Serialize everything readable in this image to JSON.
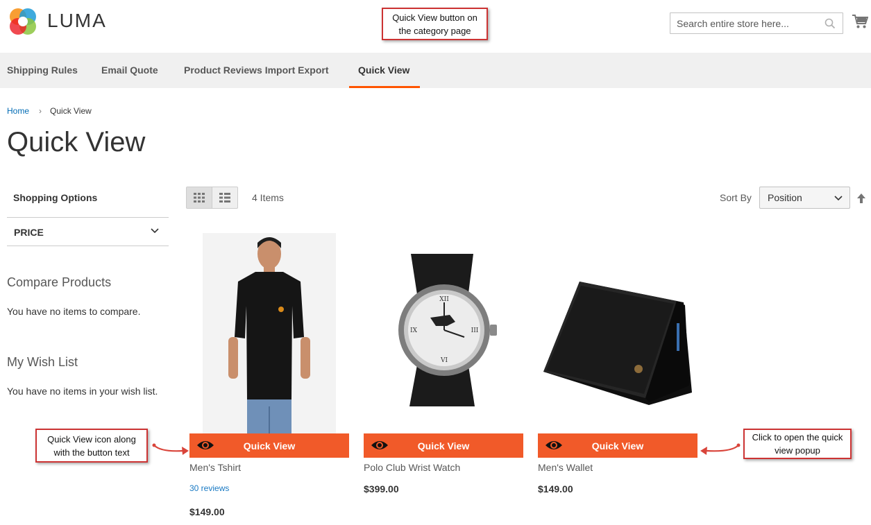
{
  "header": {
    "brand": "LUMA",
    "search_placeholder": "Search entire store here...",
    "icons": {
      "search": "search-icon",
      "cart": "cart-icon",
      "logo": "luma-logo-icon"
    }
  },
  "nav": {
    "items": [
      {
        "label": "Shipping Rules",
        "active": false
      },
      {
        "label": "Email Quote",
        "active": false
      },
      {
        "label": "Product Reviews Import Export",
        "active": false
      },
      {
        "label": "Quick View",
        "active": true
      }
    ]
  },
  "breadcrumb": {
    "home": "Home",
    "current": "Quick View"
  },
  "page_title": "Quick View",
  "sidebar": {
    "shopping_options": "Shopping Options",
    "price_filter": "PRICE",
    "compare_title": "Compare Products",
    "compare_empty": "You have no items to compare.",
    "wishlist_title": "My Wish List",
    "wishlist_empty": "You have no items in your wish list."
  },
  "toolbar": {
    "item_count": "4 Items",
    "sort_label": "Sort By",
    "sort_value": "Position",
    "view_modes": [
      "grid",
      "list"
    ],
    "active_mode": "grid"
  },
  "products": [
    {
      "name": "Men's Tshirt",
      "reviews": "30 reviews",
      "price": "$149.00",
      "button": "Quick View"
    },
    {
      "name": "Polo Club Wrist Watch",
      "price": "$399.00",
      "button": "Quick View"
    },
    {
      "name": "Men's Wallet",
      "price": "$149.00",
      "button": "Quick View"
    }
  ],
  "annotations": {
    "top": "Quick View button on the category page",
    "left": "Quick View icon along with the button text",
    "right": "Click to open the quick view popup"
  },
  "colors": {
    "accent": "#f15a29",
    "nav_active_underline": "#ff5501",
    "link": "#006bb4",
    "callout_border": "#cc3333"
  }
}
